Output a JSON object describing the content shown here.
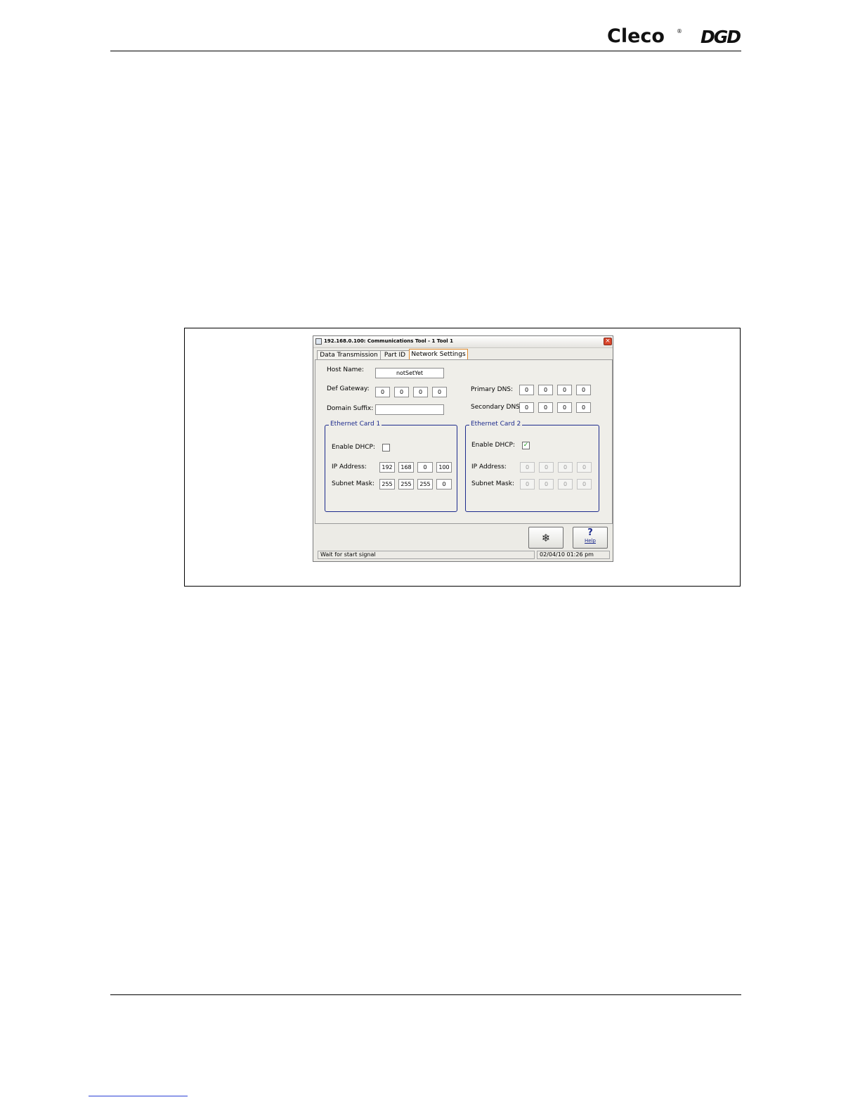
{
  "header": {
    "brand": "Cleco",
    "registered": "®",
    "brand2": "DGD"
  },
  "dialog": {
    "title": "192.168.0.100: Communications   Tool - 1   Tool 1",
    "close_glyph": "×",
    "tabs": [
      {
        "label": "Data Transmission",
        "active": false
      },
      {
        "label": "Part ID",
        "active": false
      },
      {
        "label": "Network Settings",
        "active": true
      }
    ],
    "host_name": {
      "label": "Host Name:",
      "value": "notSetYet"
    },
    "def_gateway": {
      "label": "Def Gateway:",
      "octets": [
        "0",
        "0",
        "0",
        "0"
      ]
    },
    "domain_suffix": {
      "label": "Domain Suffix:",
      "value": ""
    },
    "primary_dns": {
      "label": "Primary DNS:",
      "octets": [
        "0",
        "0",
        "0",
        "0"
      ]
    },
    "secondary_dns": {
      "label": "Secondary DNS:",
      "octets": [
        "0",
        "0",
        "0",
        "0"
      ]
    },
    "ethernet_card_1": {
      "title": "Ethernet Card 1",
      "enable_dhcp_label": "Enable DHCP:",
      "enable_dhcp_checked": false,
      "ip_address_label": "IP Address:",
      "ip_address": [
        "192",
        "168",
        "0",
        "100"
      ],
      "subnet_mask_label": "Subnet Mask:",
      "subnet_mask": [
        "255",
        "255",
        "255",
        "0"
      ]
    },
    "ethernet_card_2": {
      "title": "Ethernet Card 2",
      "enable_dhcp_label": "Enable DHCP:",
      "enable_dhcp_checked": true,
      "check_glyph": "✓",
      "ip_address_label": "IP Address:",
      "ip_address": [
        "0",
        "0",
        "0",
        "0"
      ],
      "subnet_mask_label": "Subnet Mask:",
      "subnet_mask": [
        "0",
        "0",
        "0",
        "0"
      ]
    },
    "buttons": {
      "network_glyph": "❄",
      "help_glyph": "?",
      "help_label": "Help"
    },
    "status": {
      "message": "Wait for start signal",
      "datetime": "02/04/10 01:26 pm"
    }
  }
}
